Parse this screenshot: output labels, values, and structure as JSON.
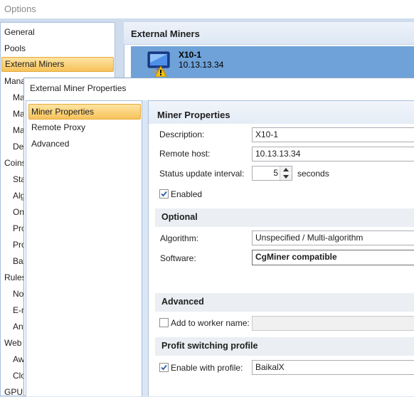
{
  "background_window": {
    "title": "Options",
    "sidebar_items": [
      {
        "label": "General",
        "selected": false
      },
      {
        "label": "Pools",
        "selected": false
      },
      {
        "label": "External Miners",
        "selected": true
      },
      {
        "label": "Mana",
        "selected": false
      },
      {
        "label": "Ma",
        "selected": false
      },
      {
        "label": "Ma",
        "selected": false
      },
      {
        "label": "Ma",
        "selected": false
      },
      {
        "label": "Dev",
        "selected": false
      },
      {
        "label": "Coins",
        "selected": false
      },
      {
        "label": "Sta",
        "selected": false
      },
      {
        "label": "Alg",
        "selected": false
      },
      {
        "label": "On",
        "selected": false
      },
      {
        "label": "Pro",
        "selected": false
      },
      {
        "label": "Pro",
        "selected": false
      },
      {
        "label": "Bal",
        "selected": false
      },
      {
        "label": "Rules",
        "selected": false
      },
      {
        "label": "Not",
        "selected": false
      },
      {
        "label": "E-m",
        "selected": false
      },
      {
        "label": "Ant",
        "selected": false
      },
      {
        "label": "Web",
        "selected": false
      },
      {
        "label": "Aw",
        "selected": false
      },
      {
        "label": "Clo",
        "selected": false
      },
      {
        "label": "GPU",
        "selected": false
      }
    ],
    "main_header": "External Miners",
    "miner": {
      "name": "X10-1",
      "host": "10.13.13.34",
      "icon": "computer-warning-icon"
    }
  },
  "dialog": {
    "title": "External Miner Properties",
    "nav_items": [
      {
        "label": "Miner Properties",
        "selected": true
      },
      {
        "label": "Remote Proxy",
        "selected": false
      },
      {
        "label": "Advanced",
        "selected": false
      }
    ],
    "header": "Miner Properties",
    "description": {
      "label": "Description:",
      "value": "X10-1"
    },
    "remote_host": {
      "label": "Remote host:",
      "value": "10.13.13.34"
    },
    "status_interval": {
      "label": "Status update interval:",
      "value": "5",
      "unit": "seconds"
    },
    "enabled": {
      "label": "Enabled",
      "checked": true
    },
    "optional": {
      "header": "Optional",
      "algorithm": {
        "label": "Algorithm:",
        "value": "Unspecified / Multi-algorithm"
      },
      "software": {
        "label": "Software:",
        "value": "CgMiner compatible"
      }
    },
    "advanced": {
      "header": "Advanced",
      "worker_name": {
        "label": "Add to worker name:",
        "checked": false,
        "value": ""
      }
    },
    "profit_switching": {
      "header": "Profit switching profile",
      "enable_profile": {
        "label": "Enable with profile:",
        "checked": true,
        "value": "BaikalX"
      }
    }
  },
  "colors": {
    "selected_gradient_top": "#fde4a3",
    "selected_gradient_bottom": "#f7c25a",
    "miner_tile": "#6fa2d8",
    "section_bg": "#ebeef3"
  }
}
